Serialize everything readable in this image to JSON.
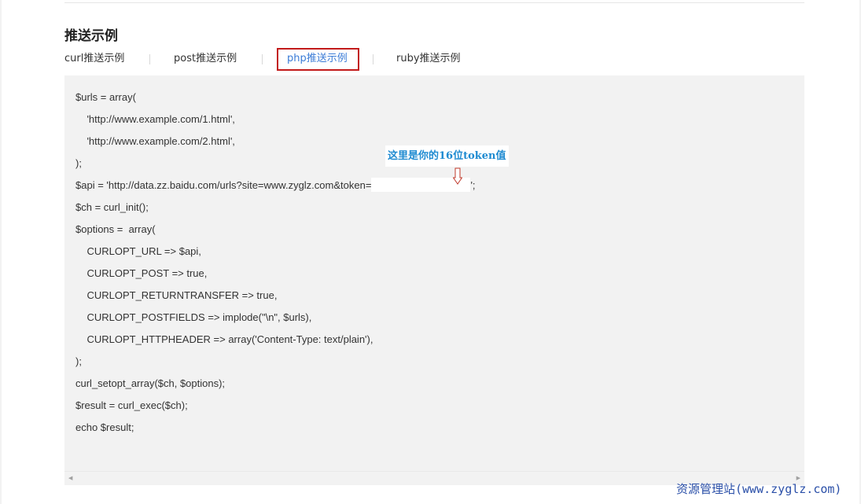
{
  "section": {
    "title": "推送示例"
  },
  "tabs": [
    {
      "label": "curl推送示例",
      "active": false
    },
    {
      "label": "post推送示例",
      "active": false
    },
    {
      "label": "php推送示例",
      "active": true
    },
    {
      "label": "ruby推送示例",
      "active": false
    }
  ],
  "code": {
    "lines": [
      "$urls = array(",
      "    'http://www.example.com/1.html',",
      "    'http://www.example.com/2.html',",
      ");",
      "$api = 'http://data.zz.baidu.com/urls?site=www.zyglz.com&token=",
      "$ch = curl_init();",
      "$options =  array(",
      "    CURLOPT_URL => $api,",
      "    CURLOPT_POST => true,",
      "    CURLOPT_RETURNTRANSFER => true,",
      "    CURLOPT_POSTFIELDS => implode(\"\\n\", $urls),",
      "    CURLOPT_HTTPHEADER => array('Content-Type: text/plain'),",
      ");",
      "curl_setopt_array($ch, $options);",
      "$result = curl_exec($ch);",
      "echo $result;"
    ],
    "api_line_suffix": "';"
  },
  "annotation": {
    "text": "这里是你的16位token值"
  },
  "watermark": {
    "text": "资源管理站(www.zyglz.com)"
  },
  "colors": {
    "active_tab": "#3b7bd6",
    "highlight_border": "#c21a1a",
    "annotation": "#1f8bd1",
    "watermark": "#2a4fa8",
    "code_bg": "#f2f2f2"
  }
}
